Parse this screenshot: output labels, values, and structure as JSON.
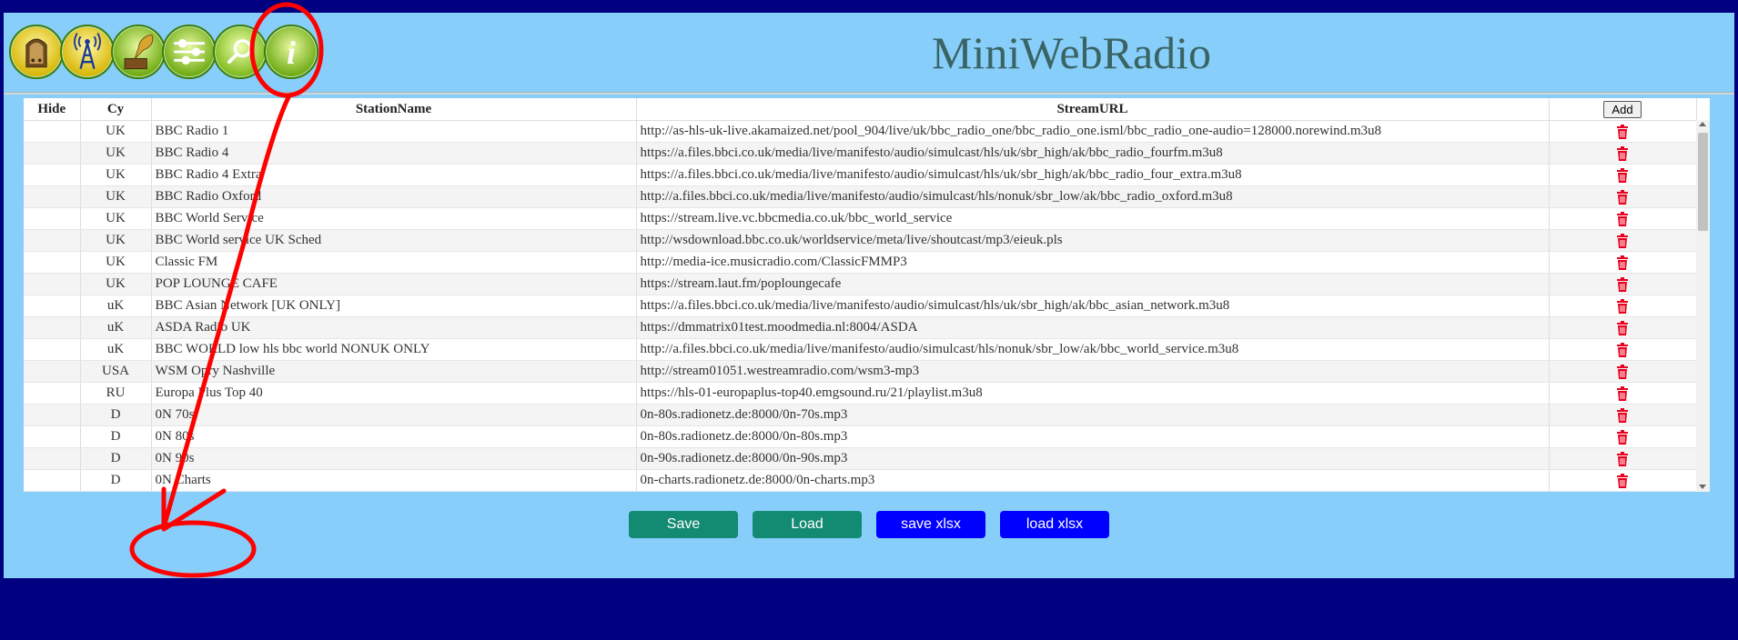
{
  "app": {
    "title": "MiniWebRadio"
  },
  "nav": [
    {
      "name": "radio-icon"
    },
    {
      "name": "antenna-icon"
    },
    {
      "name": "gramophone-icon"
    },
    {
      "name": "settings-sliders-icon"
    },
    {
      "name": "search-icon"
    },
    {
      "name": "info-icon"
    }
  ],
  "table": {
    "headers": {
      "hide": "Hide",
      "cy": "Cy",
      "name": "StationName",
      "url": "StreamURL",
      "add": "Add"
    },
    "rows": [
      {
        "cy": "UK",
        "name": "BBC Radio 1",
        "url": "http://as-hls-uk-live.akamaized.net/pool_904/live/uk/bbc_radio_one/bbc_radio_one.isml/bbc_radio_one-audio=128000.norewind.m3u8"
      },
      {
        "cy": "UK",
        "name": "BBC Radio 4",
        "url": "https://a.files.bbci.co.uk/media/live/manifesto/audio/simulcast/hls/uk/sbr_high/ak/bbc_radio_fourfm.m3u8"
      },
      {
        "cy": "UK",
        "name": "BBC Radio 4 Extra",
        "url": "https://a.files.bbci.co.uk/media/live/manifesto/audio/simulcast/hls/uk/sbr_high/ak/bbc_radio_four_extra.m3u8"
      },
      {
        "cy": "UK",
        "name": "BBC Radio Oxford",
        "url": "http://a.files.bbci.co.uk/media/live/manifesto/audio/simulcast/hls/nonuk/sbr_low/ak/bbc_radio_oxford.m3u8"
      },
      {
        "cy": "UK",
        "name": "BBC World Service",
        "url": "https://stream.live.vc.bbcmedia.co.uk/bbc_world_service"
      },
      {
        "cy": "UK",
        "name": "BBC World service UK Sched",
        "url": "http://wsdownload.bbc.co.uk/worldservice/meta/live/shoutcast/mp3/eieuk.pls"
      },
      {
        "cy": "UK",
        "name": "Classic FM",
        "url": "http://media-ice.musicradio.com/ClassicFMMP3"
      },
      {
        "cy": "UK",
        "name": "POP LOUNGE CAFE",
        "url": "https://stream.laut.fm/poploungecafe"
      },
      {
        "cy": "uK",
        "name": "BBC Asian Network [UK ONLY]",
        "url": "https://a.files.bbci.co.uk/media/live/manifesto/audio/simulcast/hls/uk/sbr_high/ak/bbc_asian_network.m3u8"
      },
      {
        "cy": "uK",
        "name": "ASDA Radio UK",
        "url": "https://dmmatrix01test.moodmedia.nl:8004/ASDA"
      },
      {
        "cy": "uK",
        "name": "BBC WORLD low hls bbc world NONUK ONLY",
        "url": "http://a.files.bbci.co.uk/media/live/manifesto/audio/simulcast/hls/nonuk/sbr_low/ak/bbc_world_service.m3u8"
      },
      {
        "cy": "USA",
        "name": "WSM Opry Nashville",
        "url": "http://stream01051.westreamradio.com/wsm3-mp3"
      },
      {
        "cy": "RU",
        "name": "Europa Plus Top 40",
        "url": "https://hls-01-europaplus-top40.emgsound.ru/21/playlist.m3u8"
      },
      {
        "cy": "D",
        "name": "0N 70s",
        "url": "0n-80s.radionetz.de:8000/0n-70s.mp3"
      },
      {
        "cy": "D",
        "name": "0N 80s",
        "url": "0n-80s.radionetz.de:8000/0n-80s.mp3"
      },
      {
        "cy": "D",
        "name": "0N 90s",
        "url": "0n-90s.radionetz.de:8000/0n-90s.mp3"
      },
      {
        "cy": "D",
        "name": "0N Charts",
        "url": "0n-charts.radionetz.de:8000/0n-charts.mp3"
      }
    ]
  },
  "buttons": {
    "save": "Save",
    "load": "Load",
    "save_xlsx": "save xlsx",
    "load_xlsx": "load xlsx"
  },
  "colors": {
    "background": "#000080",
    "panel": "#87cefa",
    "title": "#3a6464",
    "green_button": "#138a72",
    "blue_button": "#0000ff",
    "trash": "#e8001c",
    "annotation": "#ff0000"
  }
}
